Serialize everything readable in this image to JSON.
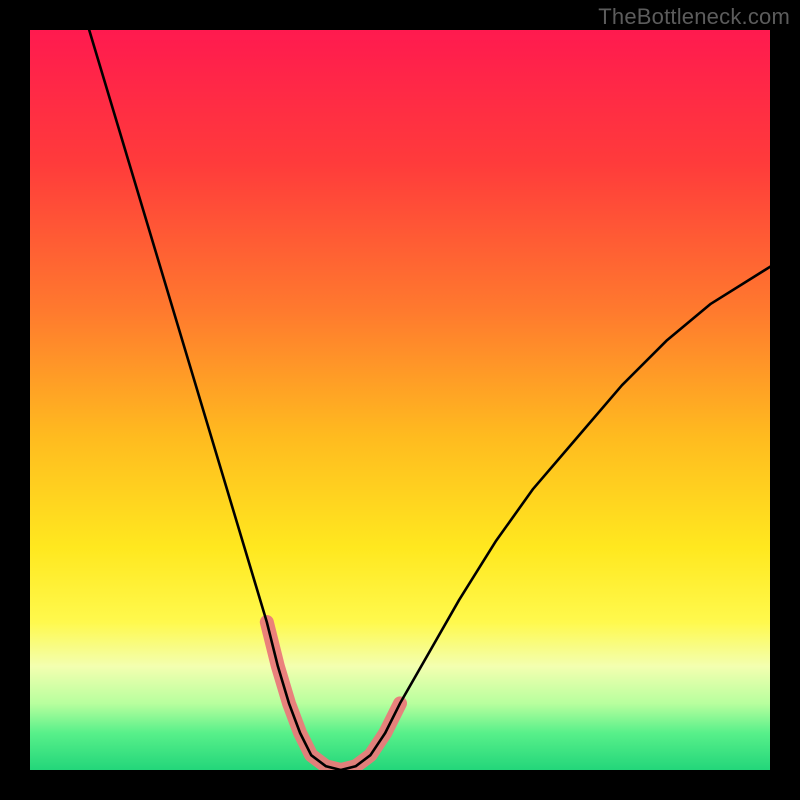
{
  "watermark": "TheBottleneck.com",
  "chart_data": {
    "type": "line",
    "title": "",
    "xlabel": "",
    "ylabel": "",
    "xlim": [
      0,
      100
    ],
    "ylim": [
      0,
      100
    ],
    "grid": false,
    "legend": false,
    "gradient_stops": [
      {
        "offset": 0.0,
        "color": "#ff1a4f"
      },
      {
        "offset": 0.18,
        "color": "#ff3b3b"
      },
      {
        "offset": 0.38,
        "color": "#ff7a2e"
      },
      {
        "offset": 0.55,
        "color": "#ffbb1f"
      },
      {
        "offset": 0.7,
        "color": "#ffe81f"
      },
      {
        "offset": 0.8,
        "color": "#fff94d"
      },
      {
        "offset": 0.86,
        "color": "#f3ffb0"
      },
      {
        "offset": 0.91,
        "color": "#b8ff9e"
      },
      {
        "offset": 0.95,
        "color": "#58f08a"
      },
      {
        "offset": 1.0,
        "color": "#23d67a"
      }
    ],
    "series": [
      {
        "name": "bottleneck-curve",
        "color": "#000000",
        "width": 2.6,
        "x": [
          8,
          11,
          14,
          17,
          20,
          23,
          26,
          29,
          32,
          33.5,
          35,
          36.5,
          38,
          40,
          42,
          44,
          46,
          48,
          50,
          54,
          58,
          63,
          68,
          74,
          80,
          86,
          92,
          100
        ],
        "values": [
          100,
          90,
          80,
          70,
          60,
          50,
          40,
          30,
          20,
          14,
          9,
          5,
          2,
          0.5,
          0,
          0.5,
          2,
          5,
          9,
          16,
          23,
          31,
          38,
          45,
          52,
          58,
          63,
          68
        ]
      },
      {
        "name": "highlight-band",
        "color": "#ea7a7a",
        "width": 14,
        "linecap": "round",
        "x": [
          32,
          33.5,
          35,
          36.5,
          38,
          40,
          42,
          44,
          46,
          48,
          50
        ],
        "values": [
          20,
          14,
          9,
          5,
          2,
          0.5,
          0,
          0.5,
          2,
          5,
          9
        ]
      }
    ]
  }
}
